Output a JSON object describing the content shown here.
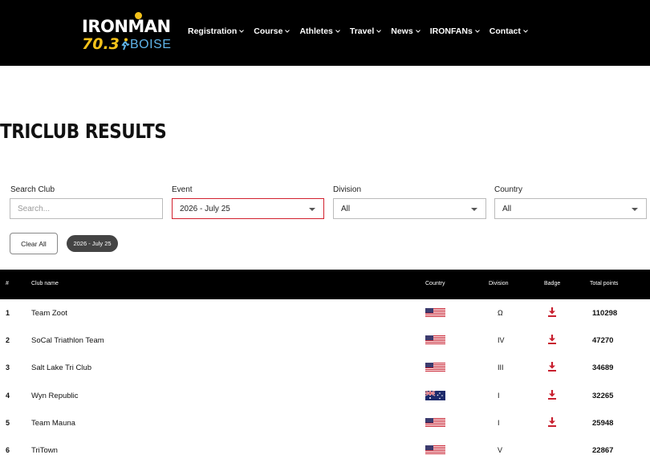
{
  "header": {
    "logo": {
      "line1": "IRONMAN",
      "line2": "70.3",
      "line3": "BOISE"
    },
    "nav": [
      "Registration",
      "Course",
      "Athletes",
      "Travel",
      "News",
      "IRONFANs",
      "Contact"
    ]
  },
  "page_title": "TRICLUB RESULTS",
  "filters": {
    "search": {
      "label": "Search Club",
      "placeholder": "Search..."
    },
    "event": {
      "label": "Event",
      "value": "2026 - July 25"
    },
    "division": {
      "label": "Division",
      "value": "All"
    },
    "country": {
      "label": "Country",
      "value": "All"
    },
    "clear_all": "Clear All",
    "active_chip": "2026 - July 25"
  },
  "table": {
    "headers": {
      "rank": "#",
      "club": "Club name",
      "country": "Country",
      "division": "Division",
      "badge": "Badge",
      "points": "Total points"
    },
    "rows": [
      {
        "rank": "1",
        "club": "Team Zoot",
        "country": "us-flag",
        "division": "Ω",
        "badge": true,
        "points": "110298"
      },
      {
        "rank": "2",
        "club": "SoCal Triathlon Team",
        "country": "us-flag",
        "division": "IV",
        "badge": true,
        "points": "47270"
      },
      {
        "rank": "3",
        "club": "Salt Lake Tri Club",
        "country": "us-flag",
        "division": "III",
        "badge": true,
        "points": "34689"
      },
      {
        "rank": "4",
        "club": "Wyn Republic",
        "country": "au-flag",
        "division": "I",
        "badge": true,
        "points": "32265"
      },
      {
        "rank": "5",
        "club": "Team Mauna",
        "country": "us-flag",
        "division": "I",
        "badge": true,
        "points": "25948"
      },
      {
        "rank": "6",
        "club": "TriTown",
        "country": "us-flag",
        "division": "V",
        "badge": false,
        "points": "22867"
      }
    ]
  },
  "colors": {
    "accent_red": "#d2202e",
    "logo_yellow": "#f4c21a",
    "logo_blue": "#5fb3e8",
    "header_bg": "#000000"
  }
}
